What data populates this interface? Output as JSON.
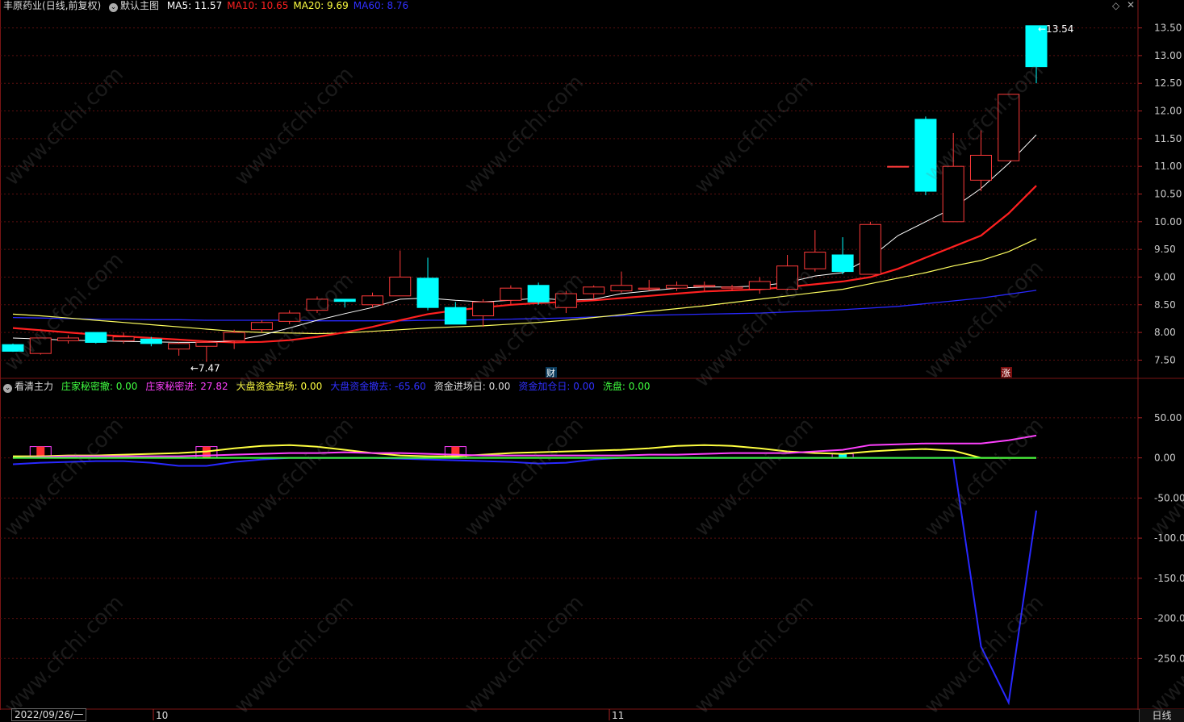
{
  "main_header": {
    "stock": "丰原药业",
    "mode": "(日线,前复权)",
    "template": "默认主图",
    "ma": [
      {
        "label": "MA5:",
        "value": "11.57",
        "color": "#ffffff"
      },
      {
        "label": "MA10:",
        "value": "10.65",
        "color": "#ff2020"
      },
      {
        "label": "MA20:",
        "value": "9.69",
        "color": "#ffff40"
      },
      {
        "label": "MA60:",
        "value": "8.76",
        "color": "#3030ff"
      }
    ]
  },
  "sub_header": {
    "name": "看清主力",
    "items": [
      {
        "label": "庄家秘密撤:",
        "value": "0.00",
        "color": "#40ff40"
      },
      {
        "label": "庄家秘密进:",
        "value": "27.82",
        "color": "#ff40ff"
      },
      {
        "label": "大盘资金进场:",
        "value": "0.00",
        "color": "#ffff40"
      },
      {
        "label": "大盘资金撤去:",
        "value": "-65.60",
        "color": "#3030ff"
      },
      {
        "label": "资金进场日:",
        "value": "0.00",
        "color": "#dddddd"
      },
      {
        "label": "资金加仓日:",
        "value": "0.00",
        "color": "#3030ff"
      },
      {
        "label": "洗盘:",
        "value": "0.00",
        "color": "#40ff40"
      }
    ]
  },
  "annotations": {
    "high_label": "13.54",
    "low_label": "←7.47",
    "event_cai": "财",
    "event_zhang": "涨"
  },
  "axis": {
    "price_ticks": [
      "13.50",
      "13.00",
      "12.50",
      "12.00",
      "11.50",
      "11.00",
      "10.50",
      "10.00",
      "9.50",
      "9.00",
      "8.50",
      "8.00",
      "7.50"
    ],
    "sub_ticks": [
      "50.00",
      "0.00",
      "-50.00",
      "-100.0",
      "-150.0",
      "-200.0",
      "-250.0"
    ],
    "date_start": "2022/09/26/一",
    "month_marks": [
      "10",
      "11"
    ],
    "period_tab": "日线"
  },
  "watermark": "www.cfchi.com",
  "chart_data": {
    "type": "candlestick",
    "price_range": [
      7.2,
      13.8
    ],
    "candles": [
      {
        "o": 7.78,
        "h": 7.8,
        "l": 7.65,
        "c": 7.66
      },
      {
        "o": 7.62,
        "h": 7.9,
        "l": 7.6,
        "c": 7.9
      },
      {
        "o": 7.85,
        "h": 7.95,
        "l": 7.8,
        "c": 7.9
      },
      {
        "o": 8.0,
        "h": 8.0,
        "l": 7.8,
        "c": 7.82
      },
      {
        "o": 7.85,
        "h": 8.0,
        "l": 7.8,
        "c": 7.92
      },
      {
        "o": 7.88,
        "h": 7.92,
        "l": 7.75,
        "c": 7.8
      },
      {
        "o": 7.7,
        "h": 7.82,
        "l": 7.58,
        "c": 7.8
      },
      {
        "o": 7.75,
        "h": 7.85,
        "l": 7.47,
        "c": 7.82
      },
      {
        "o": 7.85,
        "h": 8.05,
        "l": 7.7,
        "c": 8.0
      },
      {
        "o": 8.05,
        "h": 8.22,
        "l": 8.0,
        "c": 8.18
      },
      {
        "o": 8.2,
        "h": 8.4,
        "l": 8.15,
        "c": 8.35
      },
      {
        "o": 8.4,
        "h": 8.65,
        "l": 8.35,
        "c": 8.6
      },
      {
        "o": 8.6,
        "h": 8.58,
        "l": 8.45,
        "c": 8.56
      },
      {
        "o": 8.5,
        "h": 8.72,
        "l": 8.45,
        "c": 8.66
      },
      {
        "o": 8.66,
        "h": 9.48,
        "l": 8.66,
        "c": 9.0
      },
      {
        "o": 8.98,
        "h": 9.35,
        "l": 8.4,
        "c": 8.45
      },
      {
        "o": 8.45,
        "h": 8.55,
        "l": 8.15,
        "c": 8.15
      },
      {
        "o": 8.3,
        "h": 8.6,
        "l": 8.1,
        "c": 8.55
      },
      {
        "o": 8.58,
        "h": 8.85,
        "l": 8.5,
        "c": 8.8
      },
      {
        "o": 8.85,
        "h": 8.9,
        "l": 8.5,
        "c": 8.55
      },
      {
        "o": 8.45,
        "h": 8.75,
        "l": 8.35,
        "c": 8.7
      },
      {
        "o": 8.7,
        "h": 8.85,
        "l": 8.6,
        "c": 8.82
      },
      {
        "o": 8.75,
        "h": 9.1,
        "l": 8.72,
        "c": 8.85
      },
      {
        "o": 8.78,
        "h": 8.95,
        "l": 8.75,
        "c": 8.8
      },
      {
        "o": 8.8,
        "h": 8.92,
        "l": 8.75,
        "c": 8.85
      },
      {
        "o": 8.83,
        "h": 8.92,
        "l": 8.75,
        "c": 8.85
      },
      {
        "o": 8.8,
        "h": 8.86,
        "l": 8.75,
        "c": 8.82
      },
      {
        "o": 8.78,
        "h": 9.0,
        "l": 8.7,
        "c": 8.92
      },
      {
        "o": 8.78,
        "h": 9.4,
        "l": 8.76,
        "c": 9.2
      },
      {
        "o": 9.15,
        "h": 9.85,
        "l": 9.1,
        "c": 9.45
      },
      {
        "o": 9.4,
        "h": 9.72,
        "l": 9.05,
        "c": 9.1
      },
      {
        "o": 9.05,
        "h": 10.0,
        "l": 9.05,
        "c": 9.95
      },
      {
        "o": 11.0,
        "h": 11.0,
        "l": 11.0,
        "c": 11.0
      },
      {
        "o": 11.85,
        "h": 11.9,
        "l": 10.48,
        "c": 10.55
      },
      {
        "o": 10.0,
        "h": 11.6,
        "l": 10.0,
        "c": 11.0
      },
      {
        "o": 10.75,
        "h": 11.65,
        "l": 10.55,
        "c": 11.2
      },
      {
        "o": 11.1,
        "h": 12.3,
        "l": 11.1,
        "c": 12.3
      },
      {
        "o": 13.54,
        "h": 13.54,
        "l": 12.5,
        "c": 12.8
      }
    ],
    "ma5": [
      7.9,
      7.88,
      7.86,
      7.85,
      7.84,
      7.83,
      7.82,
      7.82,
      7.85,
      7.95,
      8.08,
      8.22,
      8.34,
      8.45,
      8.6,
      8.62,
      8.58,
      8.55,
      8.58,
      8.62,
      8.58,
      8.6,
      8.7,
      8.75,
      8.8,
      8.82,
      8.82,
      8.84,
      8.9,
      9.02,
      9.08,
      9.35,
      9.75,
      10.0,
      10.25,
      10.6,
      11.05,
      11.57
    ],
    "ma10": [
      8.08,
      8.04,
      8.0,
      7.96,
      7.93,
      7.9,
      7.87,
      7.84,
      7.82,
      7.83,
      7.86,
      7.92,
      8.0,
      8.1,
      8.22,
      8.33,
      8.4,
      8.45,
      8.5,
      8.53,
      8.55,
      8.58,
      8.62,
      8.66,
      8.7,
      8.74,
      8.76,
      8.78,
      8.82,
      8.87,
      8.92,
      9.0,
      9.15,
      9.35,
      9.55,
      9.75,
      10.15,
      10.65
    ],
    "ma20": [
      8.33,
      8.3,
      8.26,
      8.22,
      8.18,
      8.14,
      8.1,
      8.06,
      8.02,
      8.0,
      7.99,
      7.98,
      7.99,
      8.02,
      8.05,
      8.08,
      8.1,
      8.12,
      8.15,
      8.18,
      8.22,
      8.27,
      8.32,
      8.38,
      8.43,
      8.48,
      8.54,
      8.6,
      8.66,
      8.72,
      8.78,
      8.88,
      8.98,
      9.08,
      9.2,
      9.3,
      9.46,
      9.69
    ],
    "ma60": [
      8.27,
      8.26,
      8.25,
      8.24,
      8.24,
      8.23,
      8.23,
      8.22,
      8.22,
      8.22,
      8.22,
      8.21,
      8.21,
      8.21,
      8.21,
      8.22,
      8.22,
      8.23,
      8.24,
      8.25,
      8.26,
      8.28,
      8.3,
      8.31,
      8.32,
      8.33,
      8.34,
      8.35,
      8.37,
      8.39,
      8.41,
      8.44,
      8.47,
      8.52,
      8.57,
      8.62,
      8.69,
      8.76
    ],
    "sub_range": [
      -310,
      80
    ],
    "sub_yellow": [
      2,
      2,
      3,
      3,
      4,
      5,
      6,
      8,
      12,
      15,
      16,
      14,
      10,
      6,
      3,
      2,
      2,
      4,
      6,
      7,
      8,
      9,
      10,
      12,
      15,
      16,
      15,
      12,
      8,
      6,
      5,
      8,
      10,
      11,
      9,
      0,
      0,
      0
    ],
    "sub_magenta": [
      0,
      1,
      2,
      2,
      2,
      2,
      2,
      3,
      4,
      5,
      6,
      6,
      7,
      6,
      6,
      5,
      4,
      3,
      3,
      3,
      3,
      3,
      3,
      4,
      4,
      5,
      6,
      6,
      6,
      8,
      10,
      16,
      17,
      18,
      18,
      18,
      22,
      27.82
    ],
    "sub_blue": [
      -8,
      -6,
      -5,
      -4,
      -4,
      -6,
      -10,
      -10,
      -5,
      -2,
      0,
      0,
      0,
      0,
      -1,
      -2,
      -3,
      -4,
      -5,
      -7,
      -6,
      -2,
      0,
      0,
      0,
      0,
      0,
      0,
      0,
      0,
      0,
      0,
      0,
      0,
      0,
      -235,
      -305,
      -65.6
    ],
    "sub_green": [
      0,
      0,
      0,
      0,
      0,
      0,
      0,
      0,
      0,
      0,
      0,
      0,
      0,
      0,
      0,
      0,
      0,
      0,
      0,
      0,
      0,
      0,
      0,
      0,
      0,
      0,
      0,
      0,
      0,
      0,
      0,
      0,
      0,
      0,
      0,
      0,
      0,
      0
    ],
    "sub_bars": [
      {
        "i": 1,
        "h": 14,
        "color": "#ff3030"
      },
      {
        "i": 7,
        "h": 14,
        "color": "#ff3030"
      },
      {
        "i": 16,
        "h": 14,
        "color": "#ff3030"
      },
      {
        "i": 30,
        "h": 5,
        "color": "#00ffff"
      }
    ]
  }
}
